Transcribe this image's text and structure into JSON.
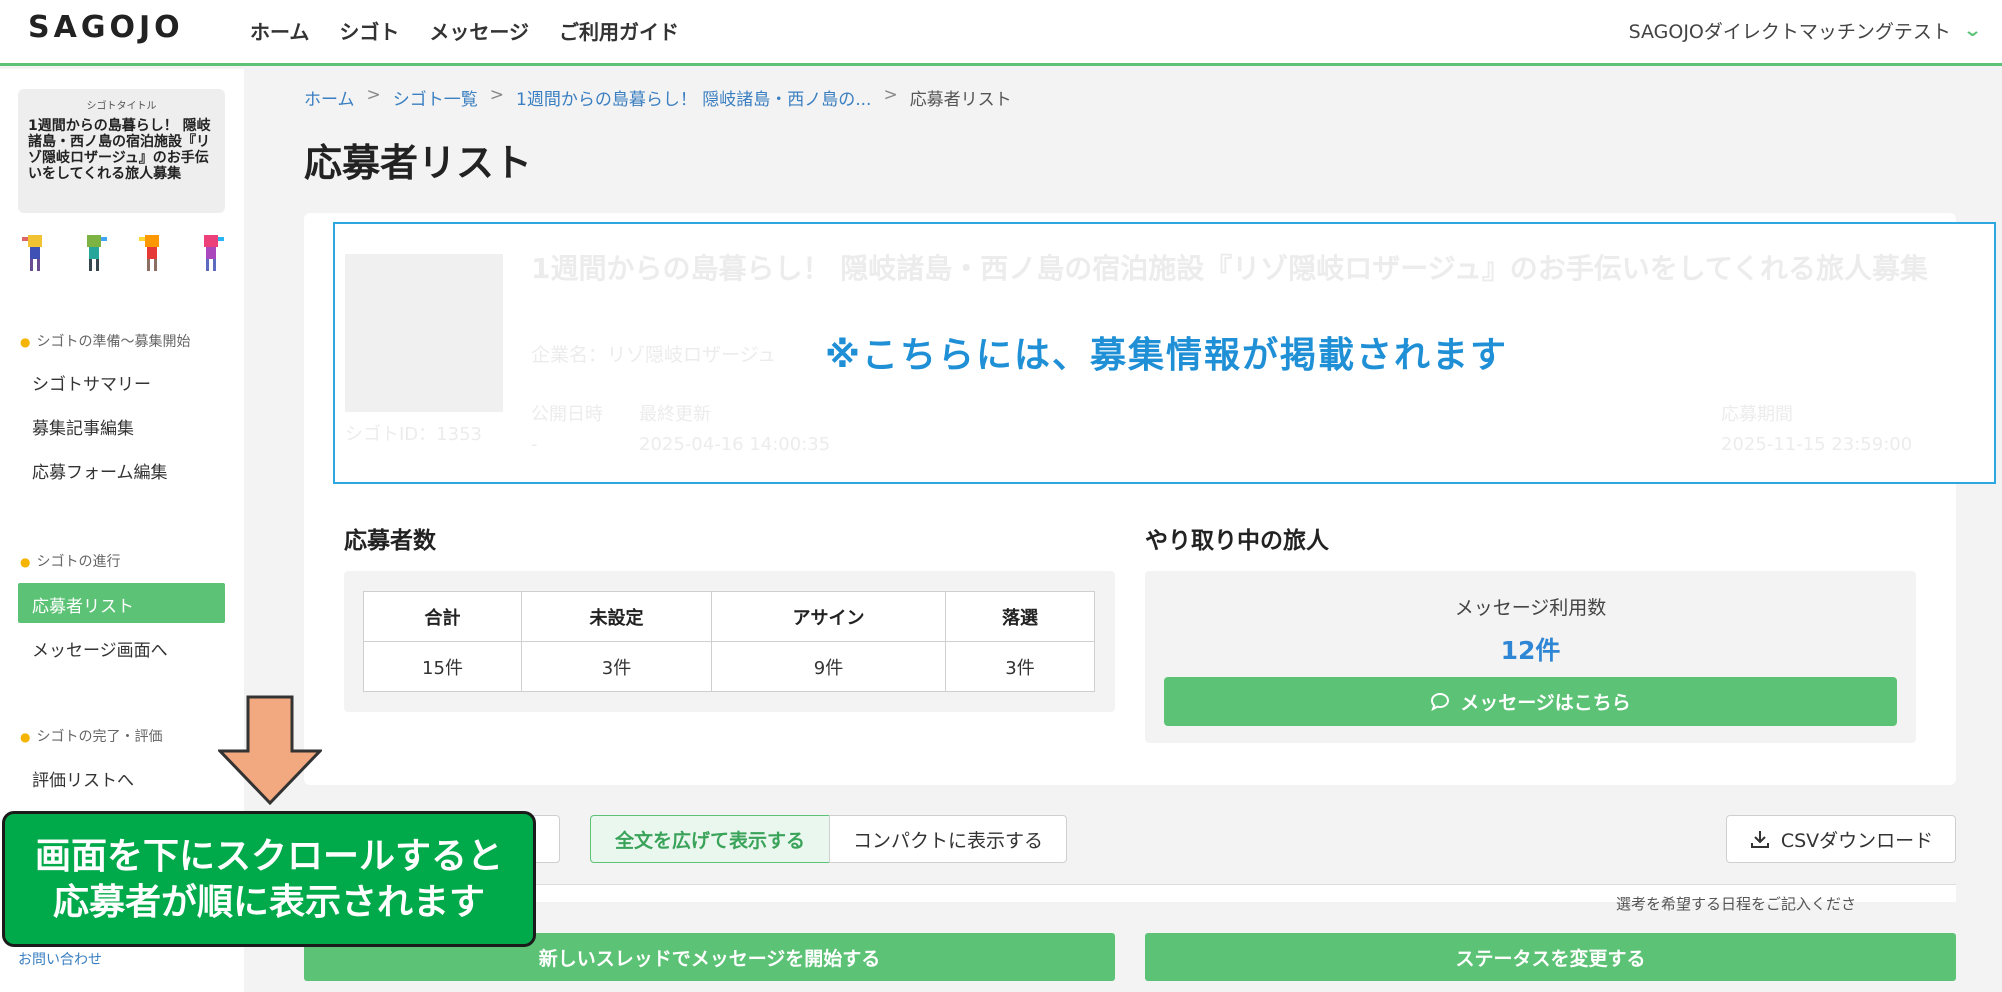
{
  "header": {
    "logo": "SAGOJO",
    "nav": [
      "ホーム",
      "シゴト",
      "メッセージ",
      "ご利用ガイド"
    ],
    "account": "SAGOJOダイレクトマッチングテスト"
  },
  "sidebar": {
    "title_caption": "シゴトタイトル",
    "title_text": "1週間からの島暮らし！ 隠岐諸島・西ノ島の宿泊施設『リゾ隠岐ロザージュ』のお手伝いをしてくれる旅人募集",
    "sections": [
      {
        "heading": "シゴトの準備〜募集開始",
        "items": [
          "シゴトサマリー",
          "募集記事編集",
          "応募フォーム編集"
        ]
      },
      {
        "heading": "シゴトの進行",
        "items": [
          "応募者リスト",
          "メッセージ画面へ"
        ]
      },
      {
        "heading": "シゴトの完了・評価",
        "items": [
          "評価リストへ"
        ]
      }
    ],
    "inquiry": "お問い合わせ"
  },
  "breadcrumb": [
    "ホーム",
    "シゴト一覧",
    "1週間からの島暮らし！ 隠岐諸島・西ノ島の...",
    "応募者リスト"
  ],
  "page_title": "応募者リスト",
  "job": {
    "title": "1週間からの島暮らし！ 隠岐諸島・西ノ島の宿泊施設『リゾ隠岐ロザージュ』のお手伝いをしてくれる旅人募集",
    "company": "企業名：リゾ隠岐ロザージュ",
    "job_id": "シゴトID：1353",
    "published_label": "公開日時",
    "published_value": "-",
    "updated_label": "最終更新",
    "updated_value": "2025-04-16 14:00:35",
    "deadline_label": "応募期間",
    "deadline_value": "2025-11-15 23:59:00",
    "notice": "※こちらには、募集情報が掲載されます"
  },
  "applicants": {
    "heading": "応募者数",
    "columns": [
      "合計",
      "未設定",
      "アサイン",
      "落選"
    ],
    "values": [
      "15件",
      "3件",
      "9件",
      "3件"
    ]
  },
  "messaging": {
    "heading": "やり取り中の旅人",
    "label": "メッセージ利用数",
    "count": "12件",
    "button": "メッセージはこちら"
  },
  "toolbar": {
    "expand": "全文を広げて表示する",
    "compact": "コンパクトに表示する",
    "csv": "CSVダウンロード"
  },
  "table_fragment": "選考を希望する日程をご記入くださ",
  "bottom": {
    "new_thread": "新しいスレッドでメッセージを開始する",
    "change_status": "ステータスを変更する"
  },
  "callout": {
    "line1": "画面を下にスクロールすると",
    "line2": "応募者が順に表示されます"
  },
  "colors": {
    "accent": "#5cc275",
    "link": "#3a7fc1",
    "notice": "#1f8fd6",
    "callout": "#00a94a",
    "arrow": "#f2a97f"
  }
}
